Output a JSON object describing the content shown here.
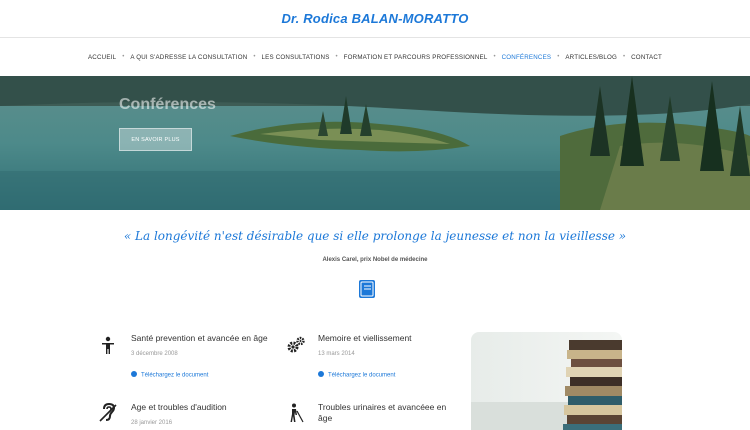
{
  "header": {
    "title": "Dr. Rodica BALAN-MORATTO"
  },
  "nav": {
    "items": [
      {
        "label": "ACCUEIL"
      },
      {
        "label": "A QUI S'ADRESSE LA CONSULTATION"
      },
      {
        "label": "LES CONSULTATIONS"
      },
      {
        "label": "FORMATION ET PARCOURS PROFESSIONNEL"
      },
      {
        "label": "CONFÉRENCES"
      },
      {
        "label": "ARTICLES/BLOG"
      },
      {
        "label": "CONTACT"
      }
    ],
    "active_index": 4,
    "separator": "•"
  },
  "hero": {
    "title": "Conférences",
    "button_label": "EN SAVOIR PLUS"
  },
  "quote": {
    "text": "« La longévité n'est désirable que si elle prolonge la jeunesse et non la vieillesse »",
    "author": "Alexis Carel, prix Nobel de médecine"
  },
  "conferences": [
    {
      "title": "Santé prevention et avancée en âge",
      "date": "3 décembre 2008",
      "link": "Téléchargez le document",
      "icon": "person-icon"
    },
    {
      "title": "Memoire et viellissement",
      "date": "13 mars 2014",
      "link": "Téléchargez le document",
      "icon": "gears-icon"
    },
    {
      "title": "Age et troubles d'audition",
      "date": "28 janvier 2016",
      "icon": "hearing-icon"
    },
    {
      "title": "Troubles urinaires et avancéee en âge",
      "icon": "walking-cane-icon"
    }
  ],
  "colors": {
    "accent": "#1c78d8",
    "text": "#333333",
    "muted": "#999999"
  }
}
